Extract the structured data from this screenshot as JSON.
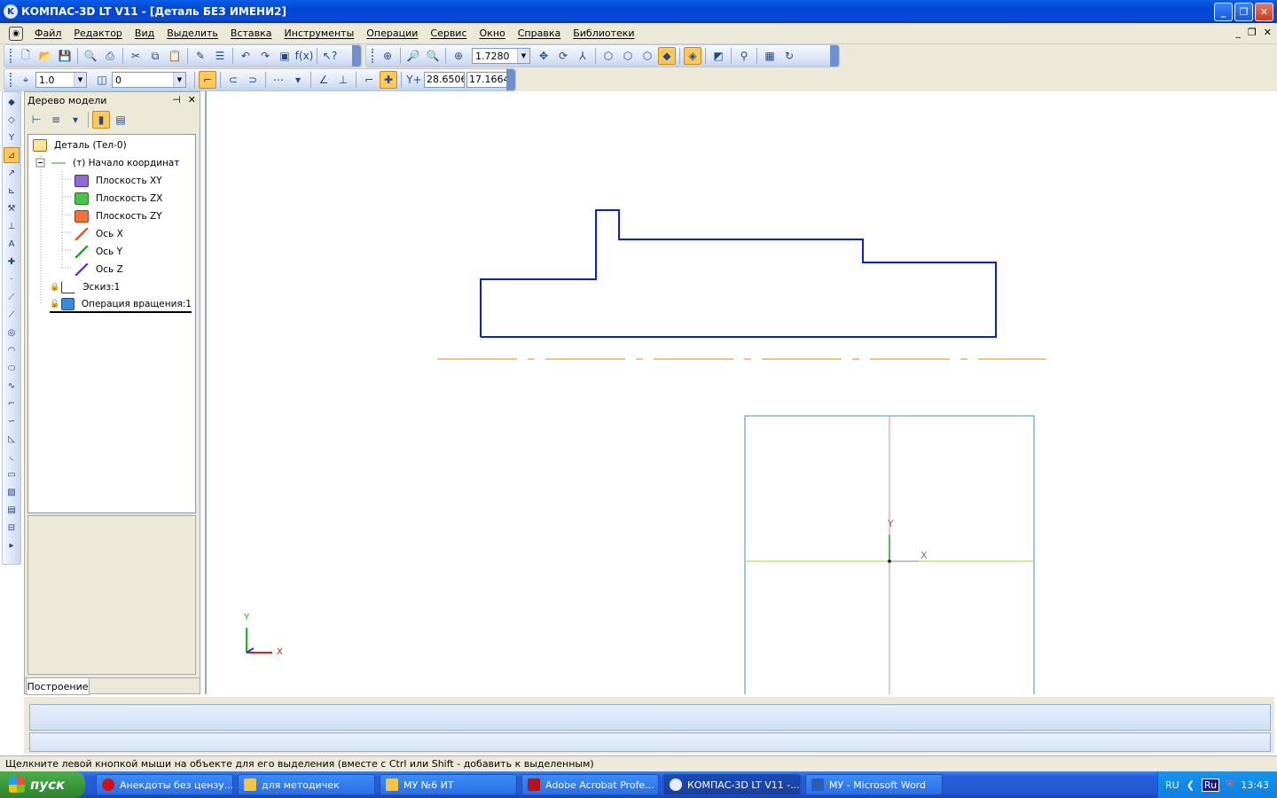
{
  "window": {
    "title": "КОМПАС-3D LT V11 - [Деталь БЕЗ ИМЕНИ2]",
    "app_icon": "kompas-icon"
  },
  "menu": [
    "Файл",
    "Редактор",
    "Вид",
    "Выделить",
    "Вставка",
    "Инструменты",
    "Операции",
    "Сервис",
    "Окно",
    "Справка",
    "Библиотеки"
  ],
  "toolbar": {
    "zoom_value": "1.7280",
    "step_value": "1.0",
    "layer_value": "0",
    "coord_x": "28.6506",
    "coord_y": "17.1664"
  },
  "panel": {
    "title": "Дерево модели",
    "tree": [
      {
        "label": "Деталь (Тел-0)",
        "icon": "part-icon"
      },
      {
        "label": "(т) Начало координат",
        "icon": "origin-icon"
      },
      {
        "label": "Плоскость XY",
        "icon": "plane-xy-icon"
      },
      {
        "label": "Плоскость ZX",
        "icon": "plane-zx-icon"
      },
      {
        "label": "Плоскость ZY",
        "icon": "plane-zy-icon"
      },
      {
        "label": "Ось X",
        "icon": "axis-x-icon"
      },
      {
        "label": "Ось Y",
        "icon": "axis-y-icon"
      },
      {
        "label": "Ось Z",
        "icon": "axis-z-icon"
      },
      {
        "label": "Эскиз:1",
        "icon": "sketch-icon"
      },
      {
        "label": "Операция вращения:1",
        "icon": "revolve-icon"
      }
    ],
    "tab": "Построение"
  },
  "canvas": {
    "axis_x": "X",
    "axis_y": "Y",
    "local_axis_x": "X",
    "local_axis_y": "Y"
  },
  "status": "Щелкните левой кнопкой мыши на объекте для его выделения (вместе с Ctrl или Shift - добавить к выделенным)",
  "taskbar": {
    "start": "пуск",
    "items": [
      {
        "label": "Анекдоты без цензу...",
        "color": "#d40f0f"
      },
      {
        "label": "для методичек",
        "color": "#f5c542"
      },
      {
        "label": "МУ №6 ИТ",
        "color": "#f5c542"
      },
      {
        "label": "Adobe Acrobat Profe...",
        "color": "#b5121b"
      },
      {
        "label": "КОМПАС-3D LT V11 -...",
        "color": "#e6eefb"
      },
      {
        "label": "МУ - Microsoft Word",
        "color": "#2b5cb8"
      }
    ],
    "lang": "RU",
    "lang_badge": "Ru",
    "clock": "13:43"
  }
}
